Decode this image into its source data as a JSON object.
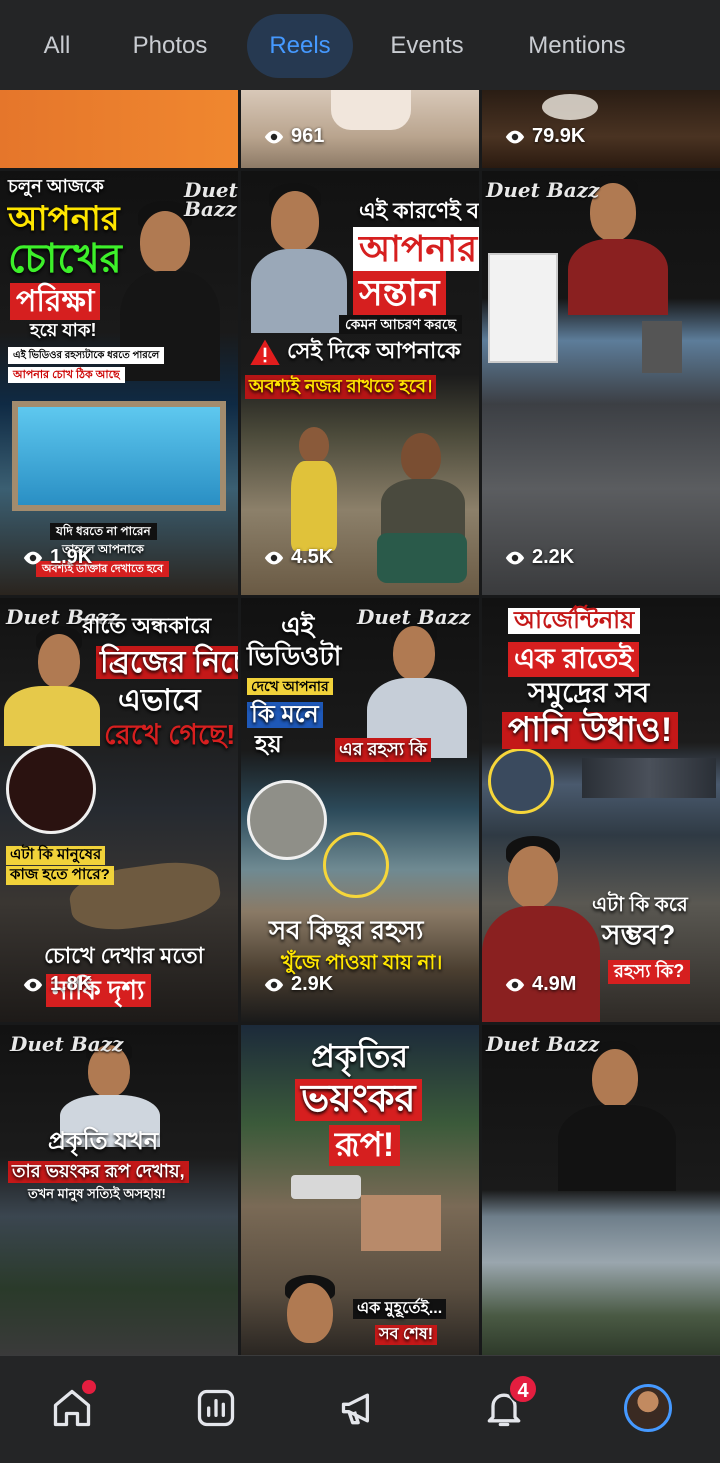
{
  "tabs": [
    {
      "label": "All"
    },
    {
      "label": "Photos"
    },
    {
      "label": "Reels"
    },
    {
      "label": "Events"
    },
    {
      "label": "Mentions"
    }
  ],
  "active_tab": "Reels",
  "reels": [
    {
      "views": ""
    },
    {
      "views": "961"
    },
    {
      "views": "79.9K"
    },
    {
      "views": "1.9K",
      "brand": "Duet Bazz",
      "lines": [
        "চলুন আজকে",
        "আপনার",
        "চোখের",
        "পরিক্ষা",
        "হয়ে যাক!",
        "এই ভিডিওর রহস্যটাকে ধরতে পারলে",
        "আপনার চোখ ঠিক আছে",
        "যদি ধরতে না পারেন",
        "তাহলে আপনাকে",
        "অবশ্যই ডাক্তার দেখাতে হবে"
      ]
    },
    {
      "views": "4.5K",
      "lines": [
        "এই কারণেই বলি",
        "আপনার",
        "সন্তান",
        "কেমন আচরণ করছে",
        "সেই দিকে আপনাকে",
        "অবশ্যই নজর রাখতে হবে।"
      ]
    },
    {
      "views": "2.2K",
      "brand": "Duet Bazz",
      "lines": [
        "আর্জেন্টিনায়",
        "এক রাতেই",
        "সমুদ্রের সব",
        "পানি উধাও!"
      ]
    },
    {
      "views": "1.8K",
      "brand": "Duet Bazz",
      "lines": [
        "রাতে অন্ধকারে",
        "ব্রিজের নিচে",
        "এভাবে",
        "রেখে গেছে!",
        "এটা কি মানুষের",
        "কাজ হতে পারে?",
        "চোখে দেখার মতো",
        "নাকি দৃশ্য"
      ]
    },
    {
      "views": "2.9K",
      "brand": "Duet Bazz",
      "lines": [
        "এই",
        "ভিডিওটা",
        "দেখে আপনার",
        "কি মনে",
        "হয়",
        "এর রহস্য কি",
        "সব কিছুর রহস্য",
        "খুঁজে পাওয়া যায় না।"
      ]
    },
    {
      "views": "4.9M",
      "lines": [
        "আর্জেন্টিনায়",
        "এক রাতেই",
        "সমুদ্রের সব",
        "পানি উধাও!",
        "এটা কি করে",
        "সম্ভব?",
        "রহস্য কি?"
      ]
    },
    {
      "views": "",
      "brand": "Duet Bazz",
      "lines": [
        "প্রকৃতি যখন",
        "তার ভয়ংকর রূপ দেখায়,",
        "তখন মানুষ সত্যিই অসহায়!"
      ]
    },
    {
      "views": "",
      "lines": [
        "প্রকৃতির",
        "ভয়ংকর",
        "রূপ!",
        "এক মুহূর্তেই...",
        "সব শেষ!"
      ]
    },
    {
      "views": "",
      "brand": "Duet Bazz"
    }
  ],
  "nav": {
    "notifications_badge": "4",
    "icons": [
      "home-icon",
      "dashboard-icon",
      "megaphone-icon",
      "bell-icon",
      "profile-avatar"
    ]
  },
  "colors": {
    "accent": "#4599ff",
    "badge": "#e41e3f",
    "bar": "#242526"
  }
}
